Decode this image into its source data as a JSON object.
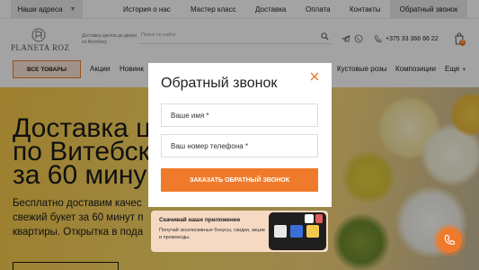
{
  "topbar": {
    "address_button": "Наши адреса",
    "links": [
      "История о нас",
      "Мастер класс",
      "Доставка",
      "Оплата",
      "Контакты"
    ],
    "callback_button": "Обратный звонок"
  },
  "header": {
    "logo_text": "PLANETA ROZ",
    "tagline": "Доставка цветов до двери по Витебску",
    "search_placeholder": "Поиск по сайту",
    "phone": "+375 33 366 66 22",
    "cart_count": "0"
  },
  "catnav": {
    "all_goods": "ВСЕ ТОВАРЫ",
    "items": [
      "Акции",
      "Новинк",
      "Кустовые розы",
      "Композиции",
      "Еще"
    ]
  },
  "hero": {
    "title_lines": [
      "Доставка ц",
      "по Витебск",
      "за 60 мину"
    ],
    "subtitle_lines": [
      "Бесплатно доставим качес",
      "свежий букет за 60 минут п",
      "квартиры. Открытка в пода"
    ]
  },
  "modal": {
    "title": "Обратный звонок",
    "name_placeholder": "Ваше имя *",
    "phone_placeholder": "Ваш номер телефона *",
    "submit_label": "ЗАКАЗАТЬ ОБРАТНЫЙ ЗВОНОК"
  },
  "app_banner": {
    "title": "Скачивай наше приложение",
    "description": "Получай эксклюзивные бонусы, скидки, акции и промокоды."
  },
  "colors": {
    "accent": "#f07a2b",
    "overlay": "rgba(0,0,0,0.36)",
    "hero_bg": "#f6c84a"
  }
}
